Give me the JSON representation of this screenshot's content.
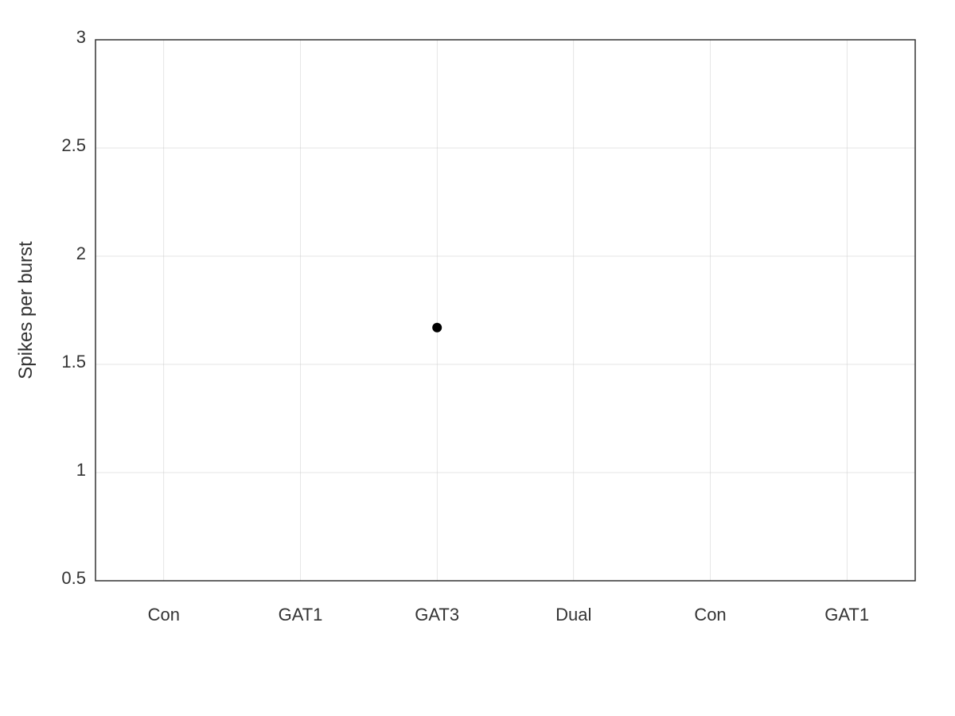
{
  "chart": {
    "title": "",
    "y_axis_label": "Spikes per burst",
    "x_axis_labels": [
      "Con",
      "GAT1",
      "GAT3",
      "Dual",
      "Con",
      "GAT1"
    ],
    "y_axis_ticks": [
      "0.5",
      "1",
      "1.5",
      "2",
      "2.5",
      "3"
    ],
    "data_points": [
      {
        "x_label": "GAT3",
        "x_index": 2,
        "y_value": 1.67
      }
    ],
    "y_min": 0.5,
    "y_max": 3.0,
    "colors": {
      "axis": "#333333",
      "grid": "#cccccc",
      "point": "#000000",
      "text": "#444444"
    }
  }
}
